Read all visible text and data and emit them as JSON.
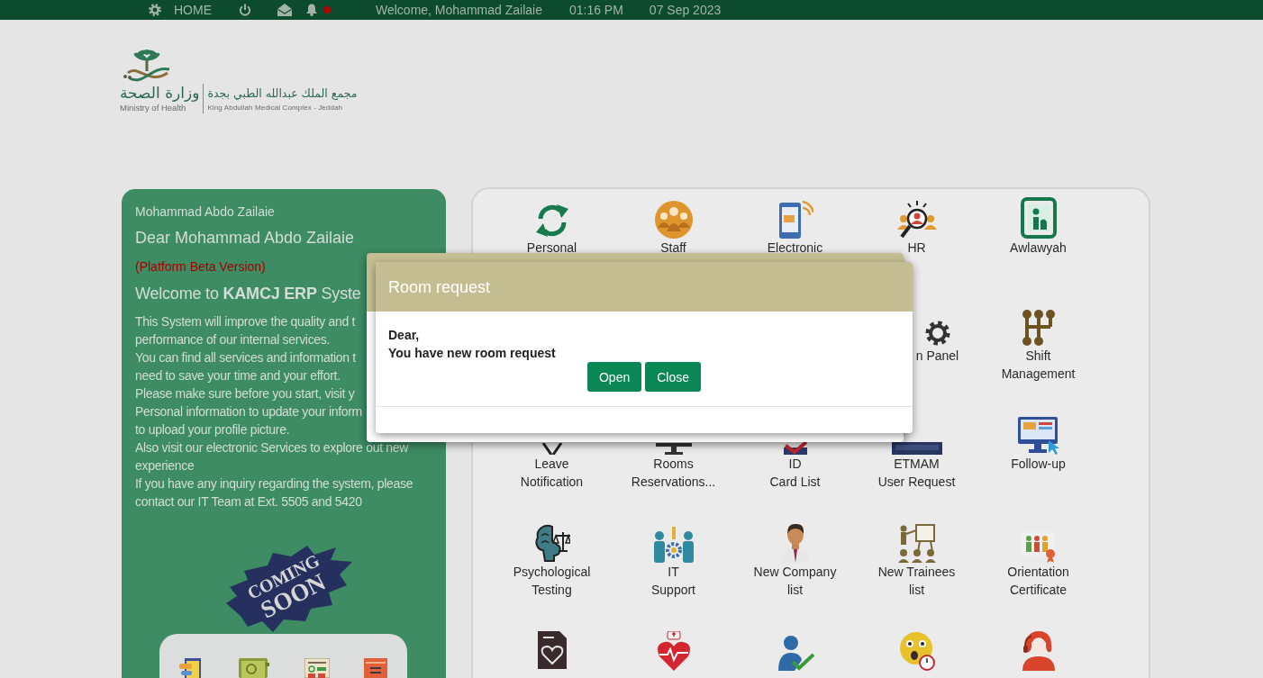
{
  "top_bar": {
    "home_label": "HOME",
    "notification_dot": true,
    "welcome": "Welcome, Mohammad Zailaie",
    "time": "01:16 PM",
    "date": "07 Sep 2023"
  },
  "logo": {
    "ministry_arabic": "وزارة الصحة",
    "ministry_english": "Ministry of Health",
    "complex_arabic": "مجمع الملك عبدالله الطبي بجدة",
    "complex_english": "King Abdullah Medical Complex - Jeddah"
  },
  "welcome_panel": {
    "user_name": "Mohammad Abdo Zailaie",
    "greeting": "Dear Mohammad Abdo Zailaie",
    "beta_note": "(Platform Beta Version)",
    "headline": "Welcome to **KAMCJ ERP** Syste",
    "message_lines": [
      "This System will improve the quality and t",
      "performance of our internal services.",
      "You can find all services and information t",
      "need to save your time and your effort.",
      "Please make sure before you start, visit y",
      "Personal information to update your inform",
      "to upload your profile picture.",
      "Also visit our electronic Services to explore out new",
      "experience",
      "If you have any inquiry regarding the system, please",
      "contact our IT Team at Ext. 5505 and 5420"
    ],
    "coming_soon": [
      "COMING",
      "SOON"
    ]
  },
  "services": {
    "rows": [
      {
        "tiles": [
          {
            "label_lines": [
              "Personal"
            ]
          },
          {
            "label_lines": [
              "Staff"
            ]
          },
          {
            "label_lines": [
              "Electronic"
            ]
          },
          {
            "label_lines": [
              "HR"
            ]
          },
          {
            "label_lines": [
              "Awlawyah"
            ]
          }
        ]
      },
      {
        "tiles": [
          {
            "label_lines": [
              "n Panel"
            ]
          },
          {
            "label_lines": [
              "Shift",
              "Management"
            ]
          }
        ]
      },
      {
        "tiles": [
          {
            "label_lines": [
              "Leave",
              "Notification"
            ]
          },
          {
            "label_lines": [
              "Rooms",
              "Reservations..."
            ]
          },
          {
            "label_lines": [
              "ID",
              "Card List"
            ]
          },
          {
            "label_lines": [
              "ETMAM",
              "User Request"
            ]
          },
          {
            "label_lines": [
              "Follow-up"
            ]
          }
        ]
      },
      {
        "tiles": [
          {
            "label_lines": [
              "Psychological",
              "Testing"
            ]
          },
          {
            "label_lines": [
              "IT",
              "Support"
            ]
          },
          {
            "label_lines": [
              "New Company",
              "list"
            ]
          },
          {
            "label_lines": [
              "New Trainees",
              "list"
            ]
          },
          {
            "label_lines": [
              "Orientation",
              "Certificate"
            ]
          }
        ]
      }
    ]
  },
  "dialog": {
    "title": "Room request",
    "message_lines": [
      "Dear,",
      "You have new room request"
    ],
    "buttons": [
      "Open",
      "Close"
    ]
  }
}
